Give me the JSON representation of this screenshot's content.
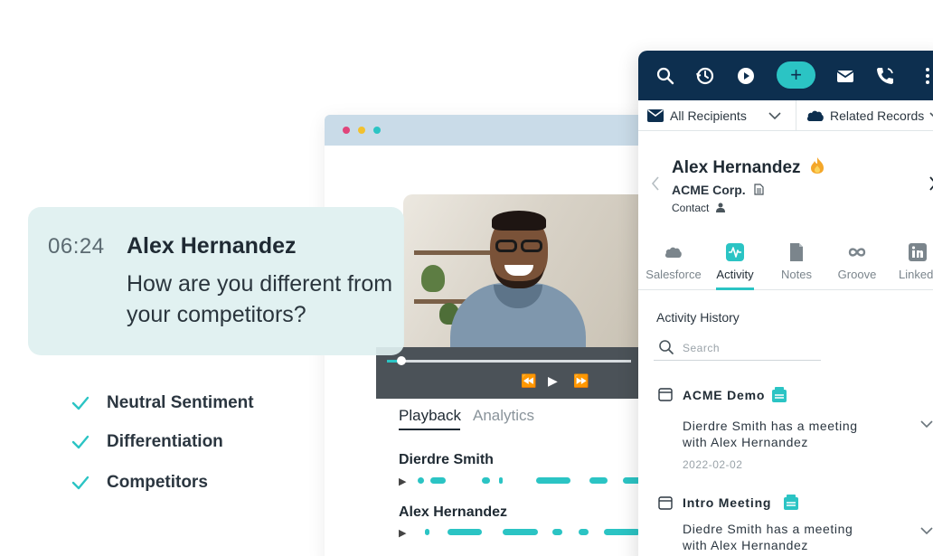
{
  "caption": {
    "timestamp": "06:24",
    "speaker": "Alex Hernandez",
    "question": "How are you different from your competitors?"
  },
  "insights": [
    "Neutral Sentiment",
    "Differentiation",
    "Competitors"
  ],
  "playback": {
    "progress_fraction": 0.06,
    "tabs": {
      "active": "Playback",
      "inactive": "Analytics"
    },
    "speakers": [
      {
        "name": "Dierdre Smith"
      },
      {
        "name": "Alex Hernandez"
      }
    ]
  },
  "panel": {
    "recipients_label": "All Recipients",
    "related_label": "Related Records",
    "contact": {
      "name": "Alex Hernandez",
      "company": "ACME Corp.",
      "role": "Contact"
    },
    "tabs": [
      "Salesforce",
      "Activity",
      "Notes",
      "Groove",
      "LinkedI"
    ],
    "active_tab": "Activity",
    "activity_history_title": "Activity History",
    "search_placeholder": "Search",
    "activities": [
      {
        "title": "ACME Demo",
        "description": "Dierdre Smith has a meeting with Alex Hernandez",
        "date": "2022-02-02"
      },
      {
        "title": "Intro Meeting",
        "description": "Diedre Smith has a meeting with Alex Hernandez",
        "date": ""
      }
    ]
  },
  "colors": {
    "accent": "#2bc4c4",
    "toolbar": "#0d2f4f",
    "caption_bg": "#def0f0"
  },
  "icons": [
    "search-icon",
    "history-icon",
    "play-icon",
    "add-icon",
    "mail-icon",
    "phone-icon",
    "more-icon",
    "envelope-icon",
    "salesforce-cloud-icon",
    "fire-emoji-icon",
    "document-icon",
    "person-icon",
    "activity-icon",
    "notes-icon",
    "groove-icon",
    "linkedin-icon",
    "calendar-icon",
    "meeting-icon",
    "chevron-down-icon",
    "check-icon"
  ]
}
